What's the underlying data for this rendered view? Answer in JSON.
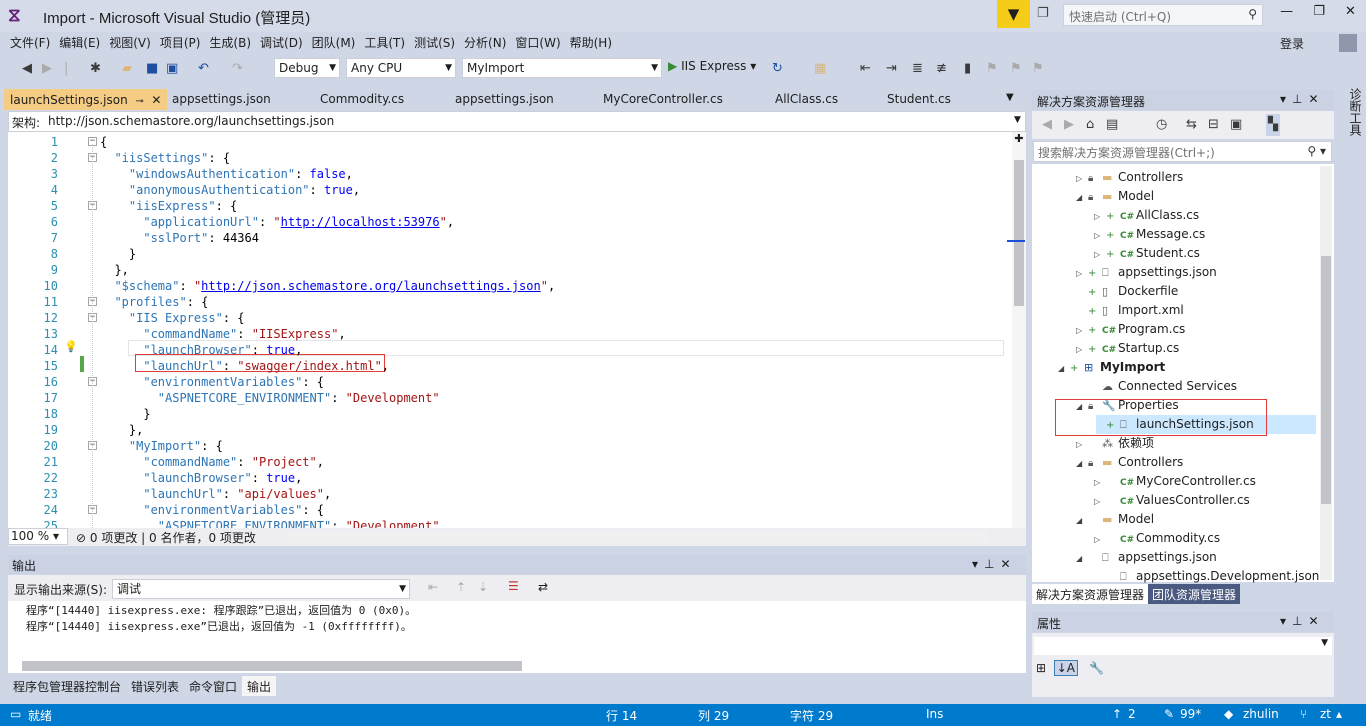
{
  "window": {
    "title": "Import - Microsoft Visual Studio (管理员)",
    "quick_launch_placeholder": "快速启动 (Ctrl+Q)",
    "login": "登录"
  },
  "menu": [
    "文件(F)",
    "编辑(E)",
    "视图(V)",
    "项目(P)",
    "生成(B)",
    "调试(D)",
    "团队(M)",
    "工具(T)",
    "测试(S)",
    "分析(N)",
    "窗口(W)",
    "帮助(H)"
  ],
  "toolbar": {
    "configuration": "Debug",
    "platform": "Any CPU",
    "startup_project": "MyImport",
    "run_label": "IIS Express"
  },
  "editor_tabs": [
    {
      "label": "launchSettings.json",
      "active": true
    },
    {
      "label": "appsettings.json"
    },
    {
      "label": "Commodity.cs"
    },
    {
      "label": "appsettings.json"
    },
    {
      "label": "MyCoreController.cs"
    },
    {
      "label": "AllClass.cs"
    },
    {
      "label": "Student.cs"
    }
  ],
  "nav": {
    "label": "架构:",
    "schema_url": "http://json.schemastore.org/launchsettings.json"
  },
  "code_lines": [
    "{",
    "  \"iisSettings\": {",
    "    \"windowsAuthentication\": false,",
    "    \"anonymousAuthentication\": true,",
    "    \"iisExpress\": {",
    "      \"applicationUrl\": \"http://localhost:53976\",",
    "      \"sslPort\": 44364",
    "    }",
    "  },",
    "  \"$schema\": \"http://json.schemastore.org/launchsettings.json\",",
    "  \"profiles\": {",
    "    \"IIS Express\": {",
    "      \"commandName\": \"IISExpress\",",
    "      \"launchBrowser\": true,",
    "      \"launchUrl\": \"swagger/index.html\",",
    "      \"environmentVariables\": {",
    "        \"ASPNETCORE_ENVIRONMENT\": \"Development\"",
    "      }",
    "    },",
    "    \"MyImport\": {",
    "      \"commandName\": \"Project\",",
    "      \"launchBrowser\": true,",
    "      \"launchUrl\": \"api/values\",",
    "      \"environmentVariables\": {",
    "        \"ASPNETCORE_ENVIRONMENT\": \"Development\""
  ],
  "editor_status": {
    "zoom": "100 %",
    "changes": "0 项更改 | 0 名作者，0 项更改"
  },
  "output": {
    "title": "输出",
    "source_label": "显示输出来源(S):",
    "source_value": "调试",
    "lines": [
      "程序“[14440] iisexpress.exe: 程序跟踪”已退出，返回值为 0 (0x0)。",
      "程序“[14440] iisexpress.exe”已退出，返回值为 -1 (0xffffffff)。"
    ]
  },
  "bottom_tabs": [
    "程序包管理器控制台",
    "错误列表",
    "命令窗口",
    "输出"
  ],
  "solution_explorer": {
    "title": "解决方案资源管理器",
    "search_placeholder": "搜索解决方案资源管理器(Ctrl+;)",
    "tree": [
      {
        "label": "Controllers",
        "icon": "folder-icon"
      },
      {
        "label": "Model",
        "icon": "folder-icon"
      },
      {
        "label": "AllClass.cs",
        "icon": "csharp-icon"
      },
      {
        "label": "Message.cs",
        "icon": "csharp-icon"
      },
      {
        "label": "Student.cs",
        "icon": "csharp-icon"
      },
      {
        "label": "appsettings.json",
        "icon": "json-icon"
      },
      {
        "label": "Dockerfile",
        "icon": "file-icon"
      },
      {
        "label": "Import.xml",
        "icon": "xml-icon"
      },
      {
        "label": "Program.cs",
        "icon": "csharp-icon"
      },
      {
        "label": "Startup.cs",
        "icon": "csharp-icon"
      },
      {
        "label": "MyImport",
        "icon": "project-icon"
      },
      {
        "label": "Connected Services",
        "icon": "cloud-icon"
      },
      {
        "label": "Properties",
        "icon": "wrench-icon"
      },
      {
        "label": "launchSettings.json",
        "icon": "json-icon"
      },
      {
        "label": "依赖项",
        "icon": "dependencies-icon"
      },
      {
        "label": "Controllers",
        "icon": "folder-icon"
      },
      {
        "label": "MyCoreController.cs",
        "icon": "csharp-icon"
      },
      {
        "label": "ValuesController.cs",
        "icon": "csharp-icon"
      },
      {
        "label": "Model",
        "icon": "folder-icon"
      },
      {
        "label": "Commodity.cs",
        "icon": "csharp-icon"
      },
      {
        "label": "appsettings.json",
        "icon": "json-icon"
      },
      {
        "label": "appsettings.Development.json",
        "icon": "json-icon"
      }
    ],
    "tabs": [
      "解决方案资源管理器",
      "团队资源管理器"
    ]
  },
  "properties": {
    "title": "属性"
  },
  "right_edge_label": "诊断工具",
  "status_bar": {
    "state": "就绪",
    "line": "行 14",
    "col": "列 29",
    "char": "字符 29",
    "mode": "Ins",
    "arrows": "2",
    "pencil": "99*",
    "user": "zhulin",
    "branch": "zt"
  },
  "colors": {
    "status_bar": "#007acc",
    "active_tab": "#f5cc84",
    "selection": "#cce8ff",
    "highlight_box": "#e03c3c"
  }
}
